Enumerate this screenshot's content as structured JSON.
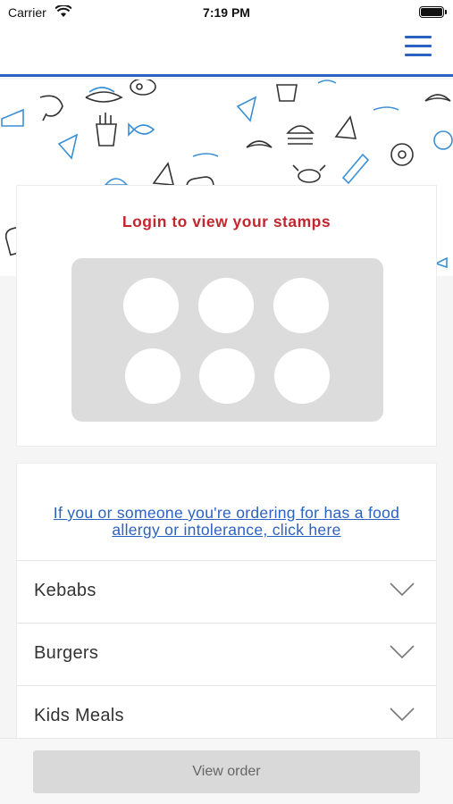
{
  "status_bar": {
    "carrier": "Carrier",
    "time": "7:19 PM"
  },
  "nav": {
    "menu_icon": "hamburger-menu-icon"
  },
  "background_pattern": {
    "icons": [
      "toast",
      "shrimp",
      "hotdog",
      "steak",
      "fries",
      "pizza",
      "sandwich",
      "sausage",
      "croissant",
      "burger",
      "fish",
      "crab",
      "baguette",
      "donut",
      "egg",
      "cheese"
    ]
  },
  "loyalty": {
    "title": "Login to view your stamps",
    "stamp_count": 6
  },
  "menu": {
    "allergy_link": "If you or someone you're ordering for has a food allergy or intolerance, click here",
    "categories": [
      {
        "label": "Kebabs"
      },
      {
        "label": "Burgers"
      },
      {
        "label": "Kids Meals"
      }
    ]
  },
  "footer": {
    "view_order_label": "View order"
  },
  "colors": {
    "accent": "#2b62c0",
    "title_red": "#c1272d",
    "stamp_board": "#dcdcdc"
  }
}
